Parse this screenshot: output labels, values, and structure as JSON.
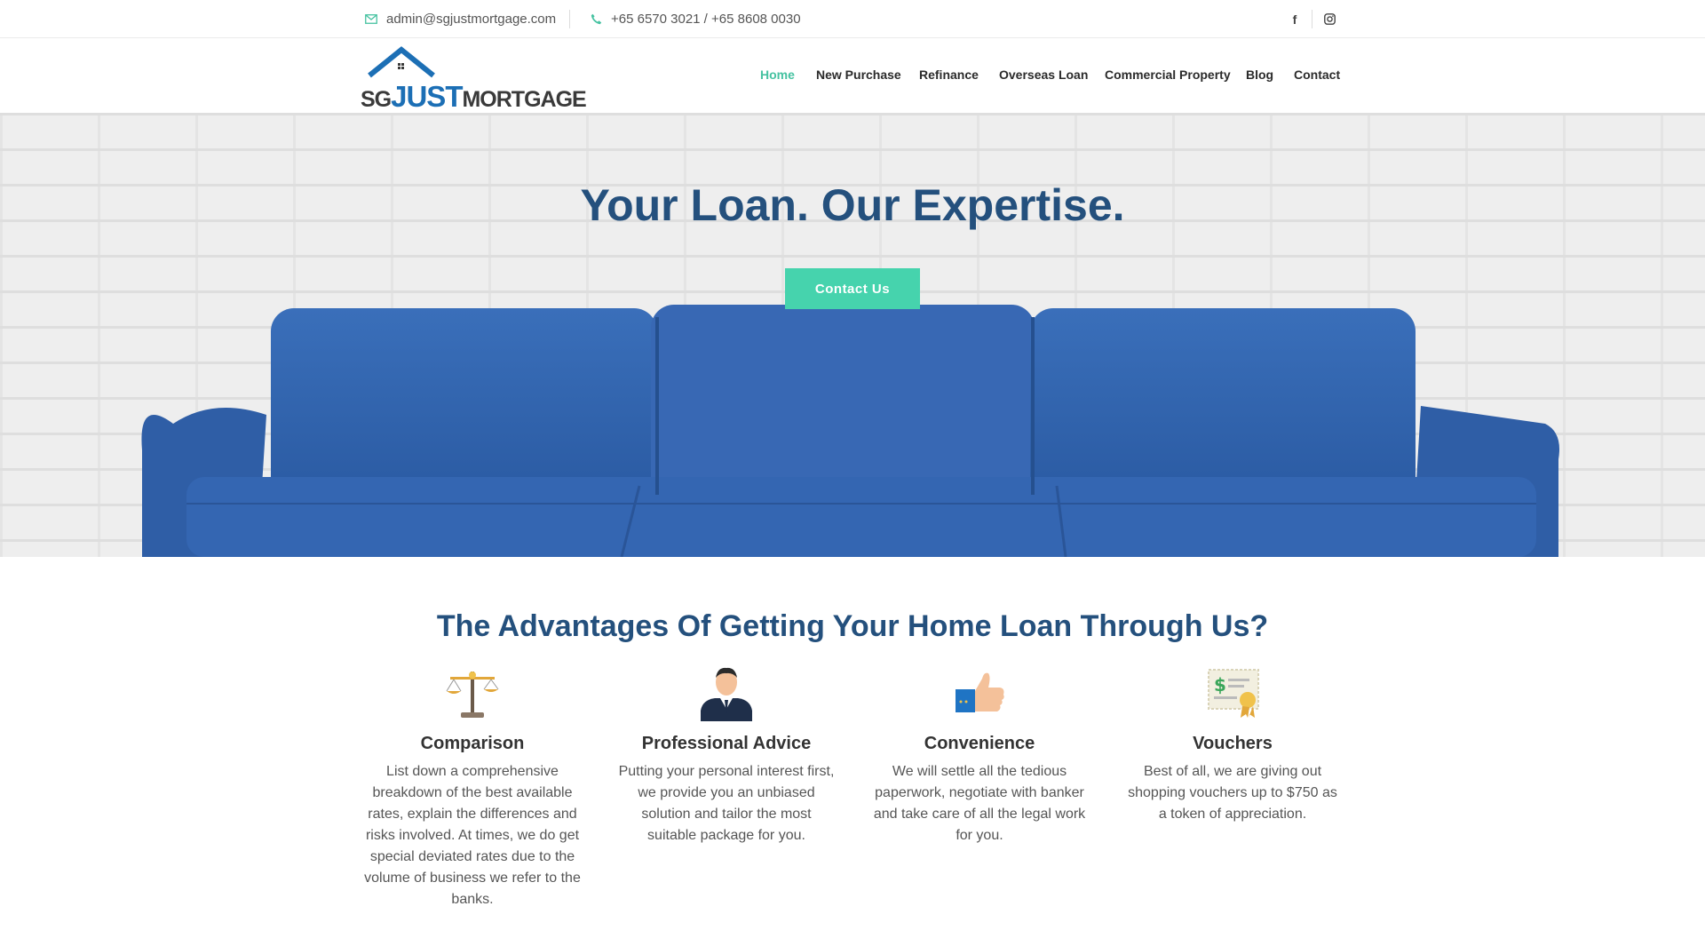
{
  "topbar": {
    "email": "admin@sgjustmortgage.com",
    "phone": "+65 6570 3021 / +65 8608 0030",
    "social": {
      "facebook_label": "f"
    }
  },
  "header": {
    "logo": {
      "part1": "SG",
      "part2": "JUST",
      "part3": "MORTGAGE"
    },
    "nav": [
      "Home",
      "New Purchase",
      "Refinance",
      "Overseas Loan",
      "Commercial Property",
      "Blog",
      "Contact"
    ],
    "active_nav": "Home"
  },
  "hero": {
    "title": "Your Loan. Our Expertise.",
    "cta": "Contact Us"
  },
  "advantages": {
    "title": "The Advantages Of Getting Your Home Loan Through Us?",
    "items": [
      {
        "icon": "scale-icon",
        "title": "Comparison",
        "text": "List down a comprehensive breakdown of the best available rates, explain the differences and risks involved. At times, we do get special deviated rates due to the volume of business we refer to the banks."
      },
      {
        "icon": "businessman-icon",
        "title": "Professional Advice",
        "text": "Putting your personal interest first, we provide you an unbiased solution and tailor the most suitable package for you."
      },
      {
        "icon": "thumbs-up-icon",
        "title": "Convenience",
        "text": "We will settle all the tedious paperwork, negotiate with banker and take care of all the legal work for you."
      },
      {
        "icon": "voucher-icon",
        "title": "Vouchers",
        "text": "Best of all, we are giving out shopping vouchers up to $750 as a token of appreciation."
      }
    ]
  },
  "colors": {
    "accent": "#46c2a1",
    "button": "#46d3ad",
    "heading": "#24507d",
    "sofa": "#3366b0",
    "logo_blue": "#1c6fb5"
  }
}
